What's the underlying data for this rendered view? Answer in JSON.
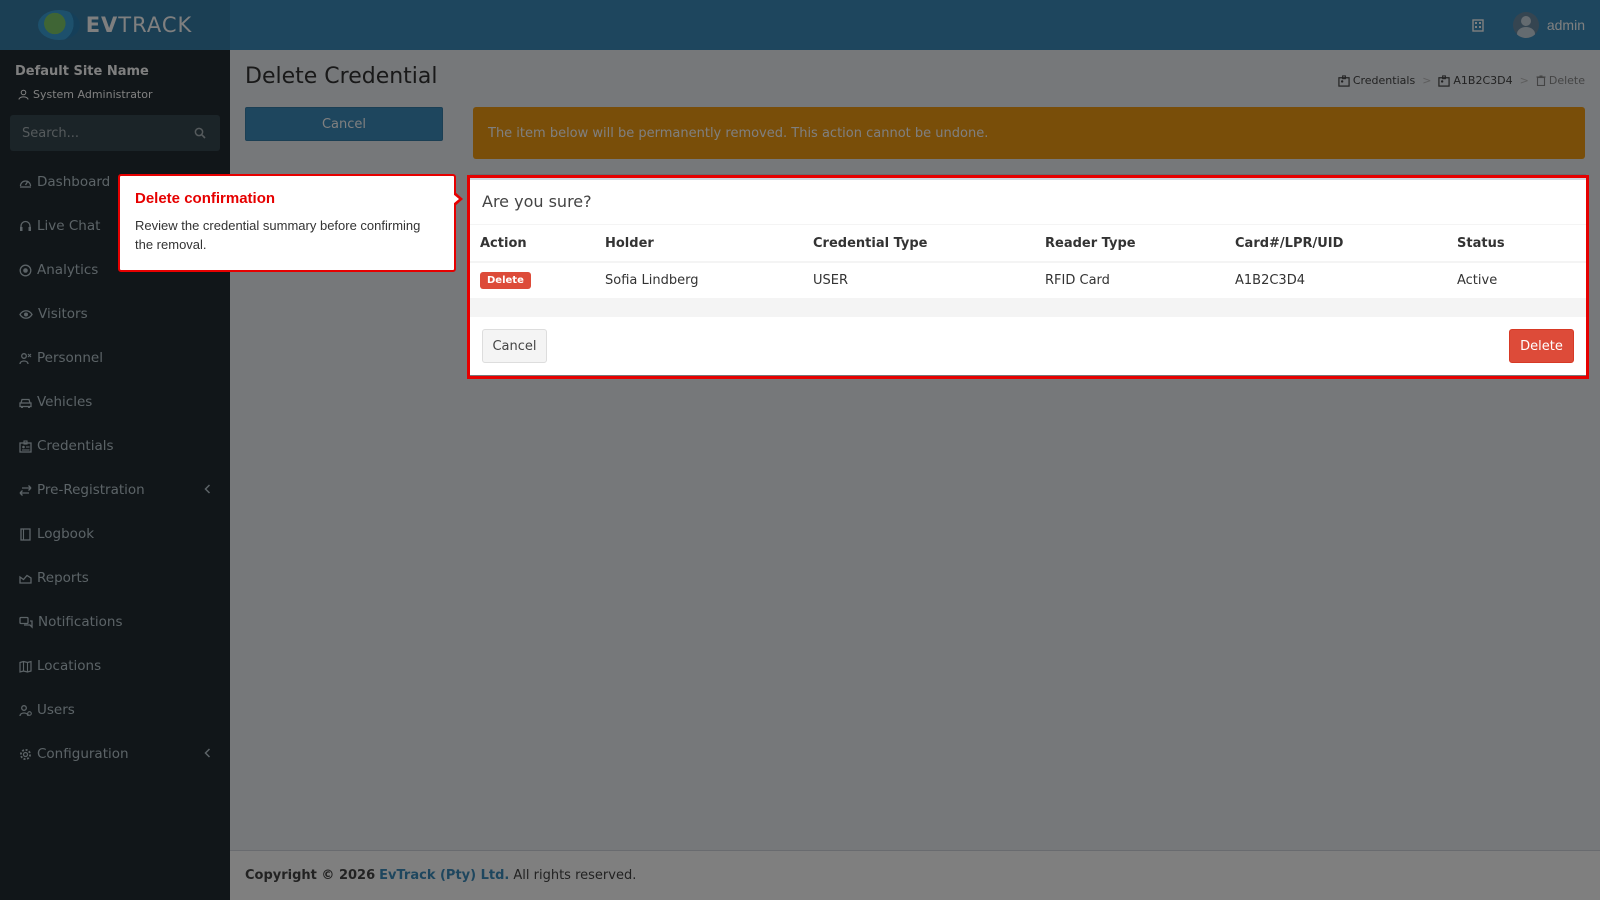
{
  "app": {
    "logo_bold": "EV",
    "logo_thin": "TRACK",
    "user_name": "admin"
  },
  "sidebar": {
    "site_name": "Default Site Name",
    "role": "System Administrator",
    "search_placeholder": "Search...",
    "items": [
      {
        "label": "Dashboard",
        "icon": "dashboard-icon"
      },
      {
        "label": "Live Chat",
        "icon": "headset-icon"
      },
      {
        "label": "Analytics",
        "icon": "target-icon"
      },
      {
        "label": "Visitors",
        "icon": "eye-icon"
      },
      {
        "label": "Personnel",
        "icon": "personnel-icon"
      },
      {
        "label": "Vehicles",
        "icon": "car-icon"
      },
      {
        "label": "Credentials",
        "icon": "id-card-icon"
      },
      {
        "label": "Pre-Registration",
        "icon": "exchange-icon"
      },
      {
        "label": "Logbook",
        "icon": "book-icon"
      },
      {
        "label": "Reports",
        "icon": "chart-icon"
      },
      {
        "label": "Notifications",
        "icon": "chat-icon"
      },
      {
        "label": "Locations",
        "icon": "map-icon"
      },
      {
        "label": "Users",
        "icon": "users-icon"
      },
      {
        "label": "Configuration",
        "icon": "gear-icon"
      }
    ]
  },
  "page": {
    "title": "Delete Credential",
    "cancel_label": "Cancel",
    "alert_text": "The item below will be permanently removed. This action cannot be undone.",
    "breadcrumb": [
      "Credentials",
      "A1B2C3D4",
      "Delete"
    ]
  },
  "box": {
    "title": "Are you sure?",
    "columns": [
      "Action",
      "Holder",
      "Credential Type",
      "Reader Type",
      "Card#/LPR/UID",
      "Status"
    ],
    "row": {
      "action": "Delete",
      "holder": "Sofia Lindberg",
      "credential_type": "USER",
      "reader_type": "RFID Card",
      "card": "A1B2C3D4",
      "status": "Active"
    },
    "cancel_label": "Cancel",
    "delete_label": "Delete"
  },
  "footer": {
    "copyright": "Copyright © 2026",
    "company": "EvTrack (Pty) Ltd.",
    "rights": "All rights reserved."
  },
  "tooltip": {
    "title": "Delete confirmation",
    "text": "Review the credential summary before confirming the removal."
  }
}
